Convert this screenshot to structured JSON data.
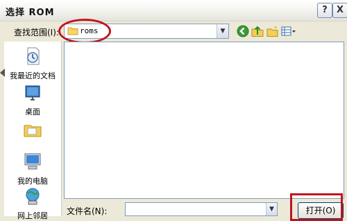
{
  "window": {
    "title": "选择 ROM",
    "help_label": "?",
    "close_label": "X"
  },
  "lookin": {
    "label": "查找范围(I):",
    "value": "roms",
    "arrow": "▼"
  },
  "toolbar": {
    "icons": [
      "back-icon",
      "up-folder-icon",
      "new-folder-icon",
      "views-menu-icon"
    ]
  },
  "places": {
    "items": [
      {
        "label": "我最近的文档",
        "icon": "recent-documents-icon"
      },
      {
        "label": "桌面",
        "icon": "desktop-icon"
      },
      {
        "label": "",
        "icon": "my-documents-icon"
      },
      {
        "label": "我的电脑",
        "icon": "my-computer-icon"
      },
      {
        "label": "网上邻居",
        "icon": "network-places-icon"
      }
    ]
  },
  "filename": {
    "label": "文件名(N):",
    "value": "",
    "arrow": "▼"
  },
  "open_button": {
    "label": "打开(O)"
  },
  "colors": {
    "annotation_red": "#c0141e",
    "dialog_bg": "#ece9d8",
    "field_border": "#7f9db9"
  }
}
